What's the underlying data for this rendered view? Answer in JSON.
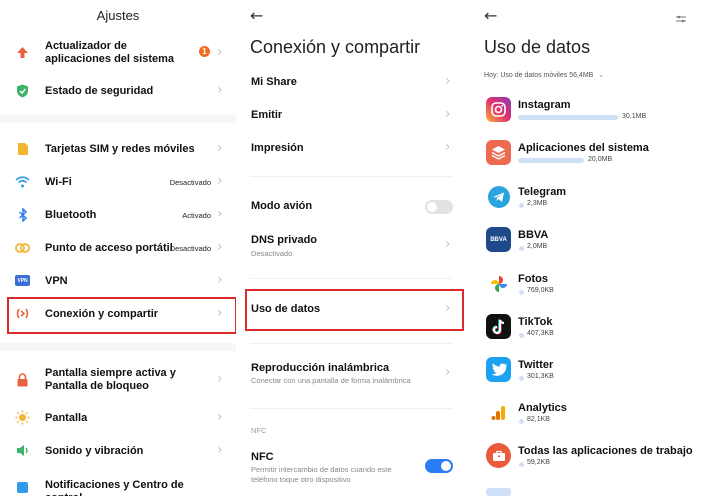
{
  "settings": {
    "title": "Ajustes",
    "items": [
      {
        "label": "Actualizador de aplicaciones del sistema",
        "badge": "1",
        "icon": "up-arrow-icon"
      },
      {
        "label": "Estado de seguridad",
        "icon": "shield-check-icon"
      },
      {
        "label": "Tarjetas SIM y redes móviles",
        "icon": "sim-card-icon"
      },
      {
        "label": "Wi-Fi",
        "status": "Desactivado",
        "icon": "wifi-icon"
      },
      {
        "label": "Bluetooth",
        "status": "Activado",
        "icon": "bluetooth-icon"
      },
      {
        "label": "Punto de acceso portátil",
        "status": "Desactivado",
        "icon": "hotspot-icon"
      },
      {
        "label": "VPN",
        "icon_text": "VPN",
        "icon": "vpn-icon"
      },
      {
        "label": "Conexión y compartir",
        "icon": "connection-sharing-icon"
      },
      {
        "label": "Pantalla siempre activa y Pantalla de bloqueo",
        "icon": "lock-icon"
      },
      {
        "label": "Pantalla",
        "icon": "sun-icon"
      },
      {
        "label": "Sonido y vibración",
        "icon": "speaker-icon"
      },
      {
        "label": "Notificaciones y Centro de control",
        "icon": "notification-icon"
      }
    ]
  },
  "connection": {
    "title": "Conexión y compartir",
    "items": [
      {
        "label": "Mi Share"
      },
      {
        "label": "Emitir"
      },
      {
        "label": "Impresión"
      },
      {
        "label": "Modo avión",
        "toggle": false
      },
      {
        "label": "DNS privado",
        "sub": "Desactivado"
      },
      {
        "label": "Uso de datos"
      },
      {
        "label": "Reproducción inalámbrica",
        "sub": "Conectar con una pantalla de forma inalámbrica"
      },
      {
        "label": "NFC",
        "sub": "Permitir intercambio de datos cuando este teléfono toque otro dispositivo",
        "toggle": true
      }
    ],
    "nfc_section": "NFC"
  },
  "data_usage": {
    "title": "Uso de datos",
    "today": "Hoy: Uso de datos móviles 56,4MB",
    "apps": [
      {
        "name": "Instagram",
        "size": "30,1MB",
        "usage_fraction": 1.0
      },
      {
        "name": "Aplicaciones del sistema",
        "size": "20,0MB",
        "usage_fraction": 0.66
      },
      {
        "name": "Telegram",
        "size": "2,3MB",
        "usage_fraction": 0
      },
      {
        "name": "BBVA",
        "size": "2,0MB",
        "usage_fraction": 0,
        "icon_text": "BBVA"
      },
      {
        "name": "Fotos",
        "size": "769,0KB",
        "usage_fraction": 0
      },
      {
        "name": "TikTok",
        "size": "407,3KB",
        "usage_fraction": 0
      },
      {
        "name": "Twitter",
        "size": "301,3KB",
        "usage_fraction": 0
      },
      {
        "name": "Analytics",
        "size": "82,1KB",
        "usage_fraction": 0
      },
      {
        "name": "Todas las aplicaciones de trabajo",
        "size": "59,2KB",
        "usage_fraction": 0
      }
    ]
  },
  "colors": {
    "highlight_border": "#d92b2b",
    "toggle_on": "#2a7df6",
    "toggle_off": "#e2e2e2",
    "usage_bar": "#cfe0f7"
  }
}
